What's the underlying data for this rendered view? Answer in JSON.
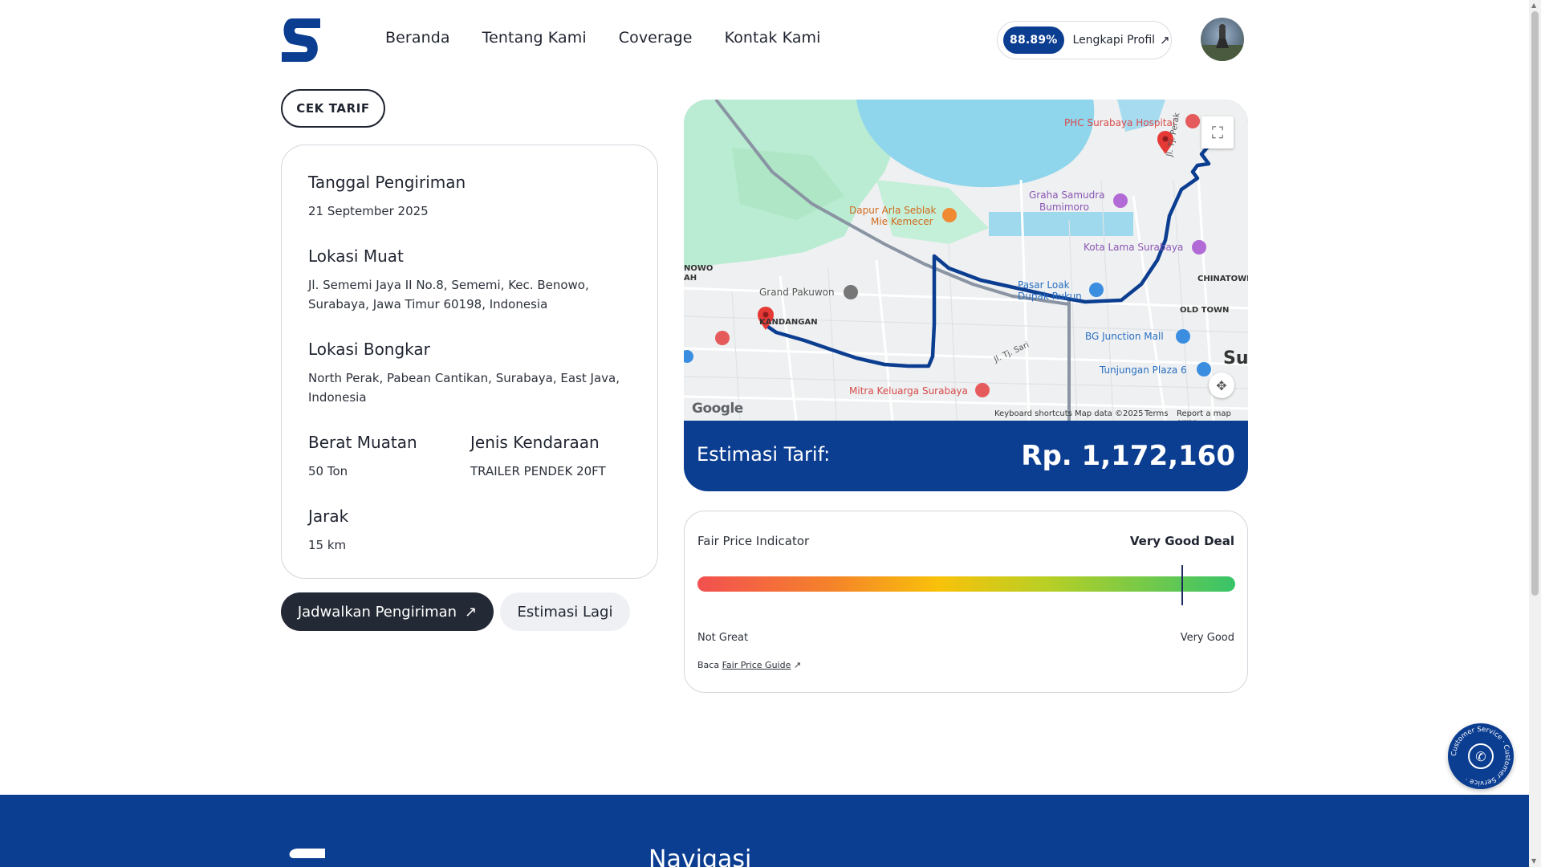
{
  "header": {
    "nav": [
      "Beranda",
      "Tentang Kami",
      "Coverage",
      "Kontak Kami"
    ],
    "profile_percent": "88.89%",
    "profile_label": "Lengkapi Profil",
    "brand_color": "#0b3d91"
  },
  "cek_tarif_button": "CEK TARIF",
  "shipment": {
    "tanggal_label": "Tanggal Pengiriman",
    "tanggal_value": "21 September 2025",
    "muat_label": "Lokasi Muat",
    "muat_value": "Jl. Sememi Jaya II No.8, Sememi, Kec. Benowo, Surabaya, Jawa Timur 60198, Indonesia",
    "bongkar_label": "Lokasi Bongkar",
    "bongkar_value": "North Perak, Pabean Cantikan, Surabaya, East Java, Indonesia",
    "berat_label": "Berat Muatan",
    "berat_value": "50 Ton",
    "jenis_label": "Jenis Kendaraan",
    "jenis_value": "TRAILER PENDEK 20FT",
    "jarak_label": "Jarak",
    "jarak_value": "15 km"
  },
  "actions": {
    "schedule": "Jadwalkan Pengiriman",
    "estimate_again": "Estimasi Lagi"
  },
  "map": {
    "labels": {
      "phc": "PHC Surabaya Hospital",
      "graha1": "Graha Samudra",
      "graha2": "Bumimoro",
      "dapur1": "Dapur Arla Seblak",
      "dapur2": "Mie Kemecer",
      "kota_lama": "Kota Lama Surabaya",
      "nowo": "NOWO",
      "ah": "AH",
      "chinatown": "CHINATOWN",
      "grand": "Grand Pakuwon",
      "kandangan": "KANDANGAN",
      "pasar1": "Pasar Loak",
      "pasar2": "Dupak Rukun",
      "old_town": "OLD TOWN",
      "bg": "BG Junction Mall",
      "su": "Su",
      "tunjungan": "Tunjungan Plaza 6",
      "mitra": "Mitra Keluarga Surabaya",
      "jl_perak": "Jl. Tj. Perak",
      "jl_sari": "Jl. Tj. Sari"
    },
    "footer": {
      "google": "Google",
      "shortcuts": "Keyboard shortcuts",
      "mapdata": "Map data ©2025",
      "terms": "Terms",
      "report": "Report a map error"
    }
  },
  "estimasi": {
    "label": "Estimasi Tarif:",
    "value": "Rp. 1,172,160"
  },
  "fair_price": {
    "title": "Fair Price Indicator",
    "deal": "Very Good Deal",
    "position": 0.9,
    "left_label": "Not Great",
    "right_label": "Very Good",
    "read_prefix": "Baca",
    "read_link": "Fair Price Guide"
  },
  "chat": {
    "ring_text": "Customer Service · Customer Service ·"
  },
  "footer": {
    "nav_title": "Navigasi"
  }
}
